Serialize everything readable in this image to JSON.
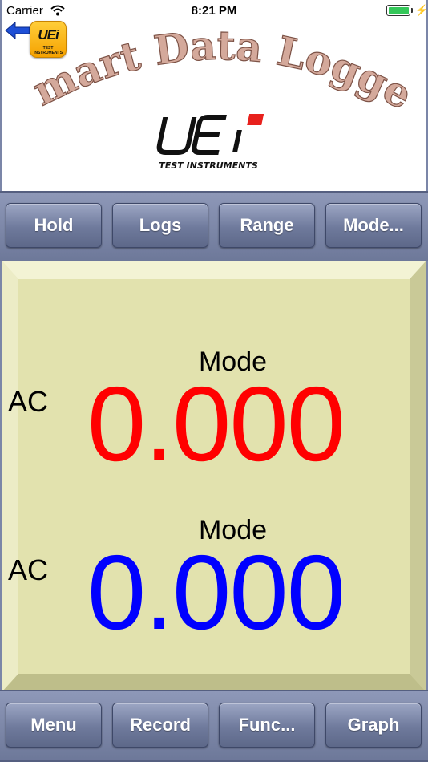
{
  "status_bar": {
    "carrier": "Carrier",
    "time": "8:21 PM",
    "battery_level": 100,
    "icons": [
      "wifi-icon",
      "battery-icon",
      "charging-icon"
    ]
  },
  "header": {
    "title": "Smart Data Logger",
    "app_icon_text": "UEi",
    "app_icon_sub": "TEST INSTRUMENTS",
    "logo_text": "UEi",
    "logo_sub": "TEST INSTRUMENTS"
  },
  "top_toolbar": [
    "Hold",
    "Logs",
    "Range",
    "Mode..."
  ],
  "readouts": [
    {
      "mode": "Mode",
      "ac": "AC",
      "value": "0.000",
      "color": "#ff0000"
    },
    {
      "mode": "Mode",
      "ac": "AC",
      "value": "0.000",
      "color": "#0000ff"
    }
  ],
  "bottom_toolbar": [
    "Menu",
    "Record",
    "Func...",
    "Graph"
  ],
  "colors": {
    "toolbar": "#7b86a8",
    "display_bg": "#e2e2ae",
    "title": "#d4a99b"
  }
}
